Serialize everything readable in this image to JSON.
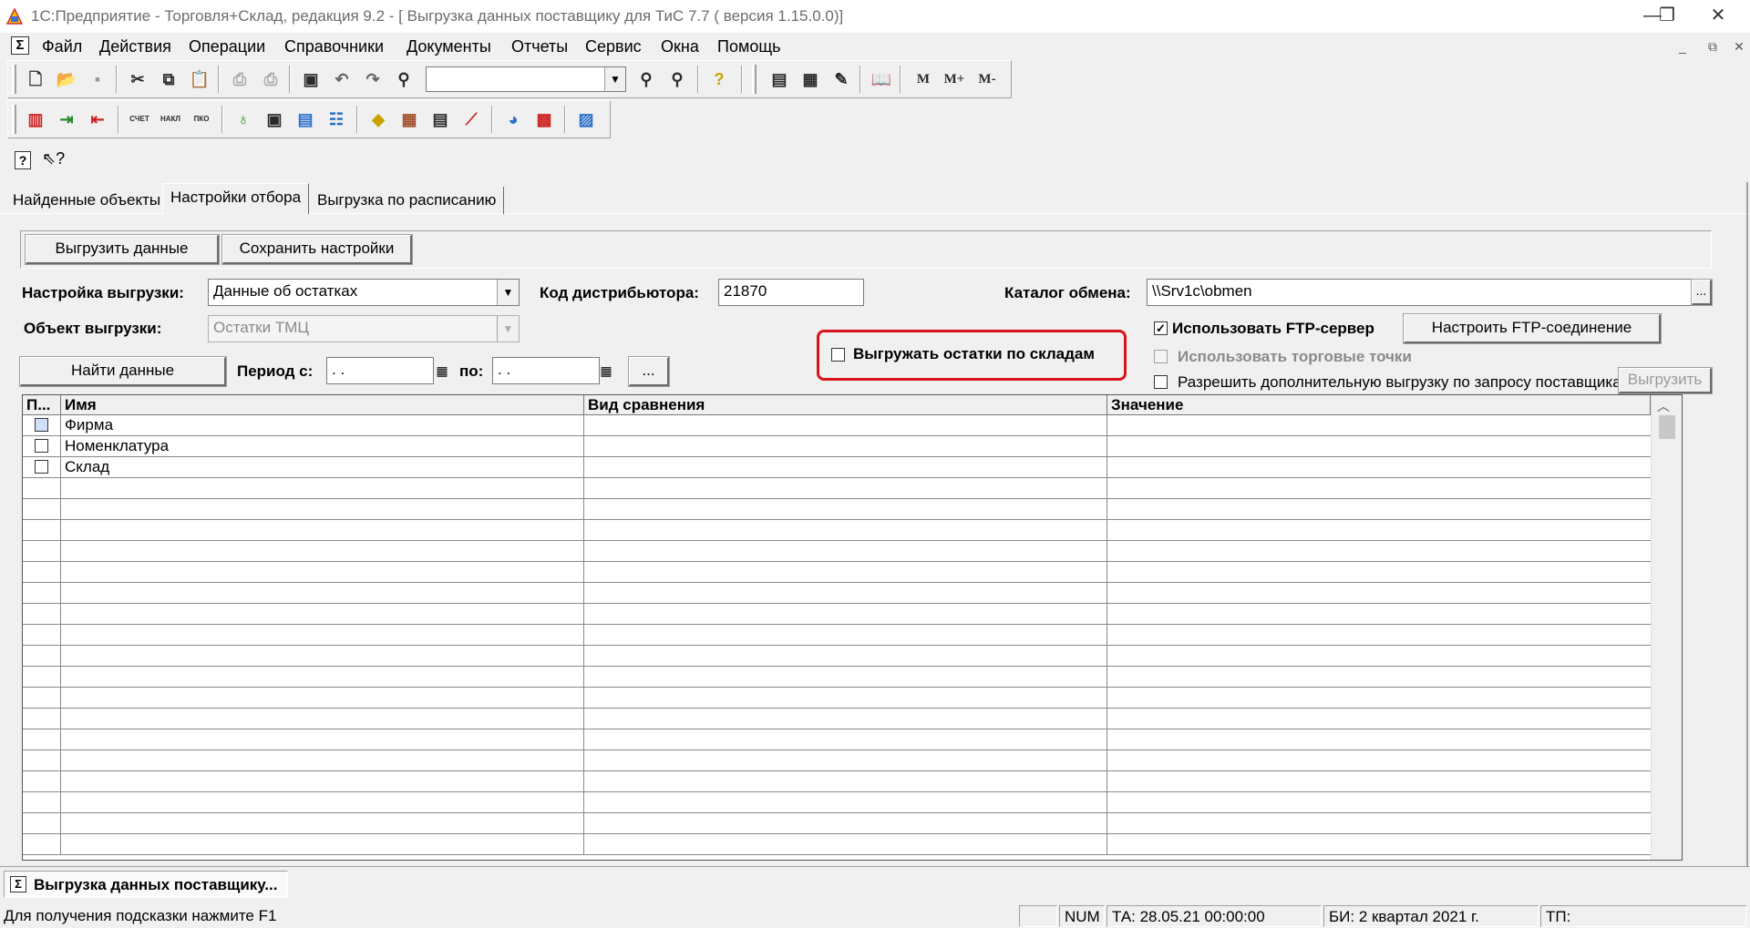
{
  "window": {
    "title": "1С:Предприятие - Торговля+Склад, редакция 9.2 - [ Выгрузка данных поставщику для ТиС 7.7 ( версия 1.15.0.0)]",
    "minimize": "—",
    "restore": "❐",
    "close": "✕"
  },
  "menu": {
    "items": [
      "Файл",
      "Действия",
      "Операции",
      "Справочники",
      "Документы",
      "Отчеты",
      "Сервис",
      "Окна",
      "Помощь"
    ]
  },
  "toolbar": {
    "memory_labels": [
      "M",
      "M+",
      "M-"
    ],
    "search_value": "",
    "label_buttons": [
      "СЧЕТ",
      "НАКЛ",
      "ПКО"
    ]
  },
  "tabs": [
    {
      "label": "Найденные объекты",
      "active": false
    },
    {
      "label": "Настройки отбора",
      "active": true
    },
    {
      "label": "Выгрузка по расписанию",
      "active": false
    }
  ],
  "form": {
    "export_button": "Выгрузить данные",
    "save_button": "Сохранить настройки",
    "export_setting_label": "Настройка выгрузки:",
    "export_setting_value": "Данные об остатках",
    "distributor_code_label": "Код дистрибьютора:",
    "distributor_code_value": "21870",
    "exchange_dir_label": "Каталог обмена:",
    "exchange_dir_value": "\\\\Srv1c\\obmen",
    "browse_button": "...",
    "export_object_label": "Объект выгрузки:",
    "export_object_value": "Остатки ТМЦ",
    "find_button": "Найти данные",
    "period_from_label": "Период с:",
    "period_from_value": " .  .",
    "period_to_label": "по:",
    "period_to_value": " .  .",
    "period_button": "...",
    "stock_by_warehouse_label": "Выгружать остатки по складам",
    "stock_by_warehouse_checked": false,
    "use_ftp_label": "Использовать FTP-сервер",
    "use_ftp_checked": true,
    "ftp_settings_button": "Настроить FTP-соединение",
    "use_outlets_label": "Использовать торговые точки",
    "use_outlets_checked": false,
    "allow_extra_label": "Разрешить дополнительную выгрузку по запросу поставщика",
    "allow_extra_checked": false,
    "export_extra_button": "Выгрузить"
  },
  "grid": {
    "columns": [
      "П...",
      "Имя",
      "Вид сравнения",
      "Значение"
    ],
    "rows": [
      {
        "use": false,
        "name": "Фирма",
        "comparison": "",
        "value": ""
      },
      {
        "use": false,
        "name": "Номенклатура",
        "comparison": "",
        "value": ""
      },
      {
        "use": false,
        "name": "Склад",
        "comparison": "",
        "value": ""
      }
    ]
  },
  "taskbar": {
    "window_label": "Выгрузка данных поставщику..."
  },
  "status": {
    "hint": "Для получения подсказки нажмите F1",
    "num": "NUM",
    "ta": "ТА: 28.05.21  00:00:00",
    "bi": "БИ: 2 квартал 2021 г.",
    "tp": "ТП:"
  },
  "colors": {
    "highlight_border": "#d9141b",
    "chrome": "#f0f0f0"
  }
}
